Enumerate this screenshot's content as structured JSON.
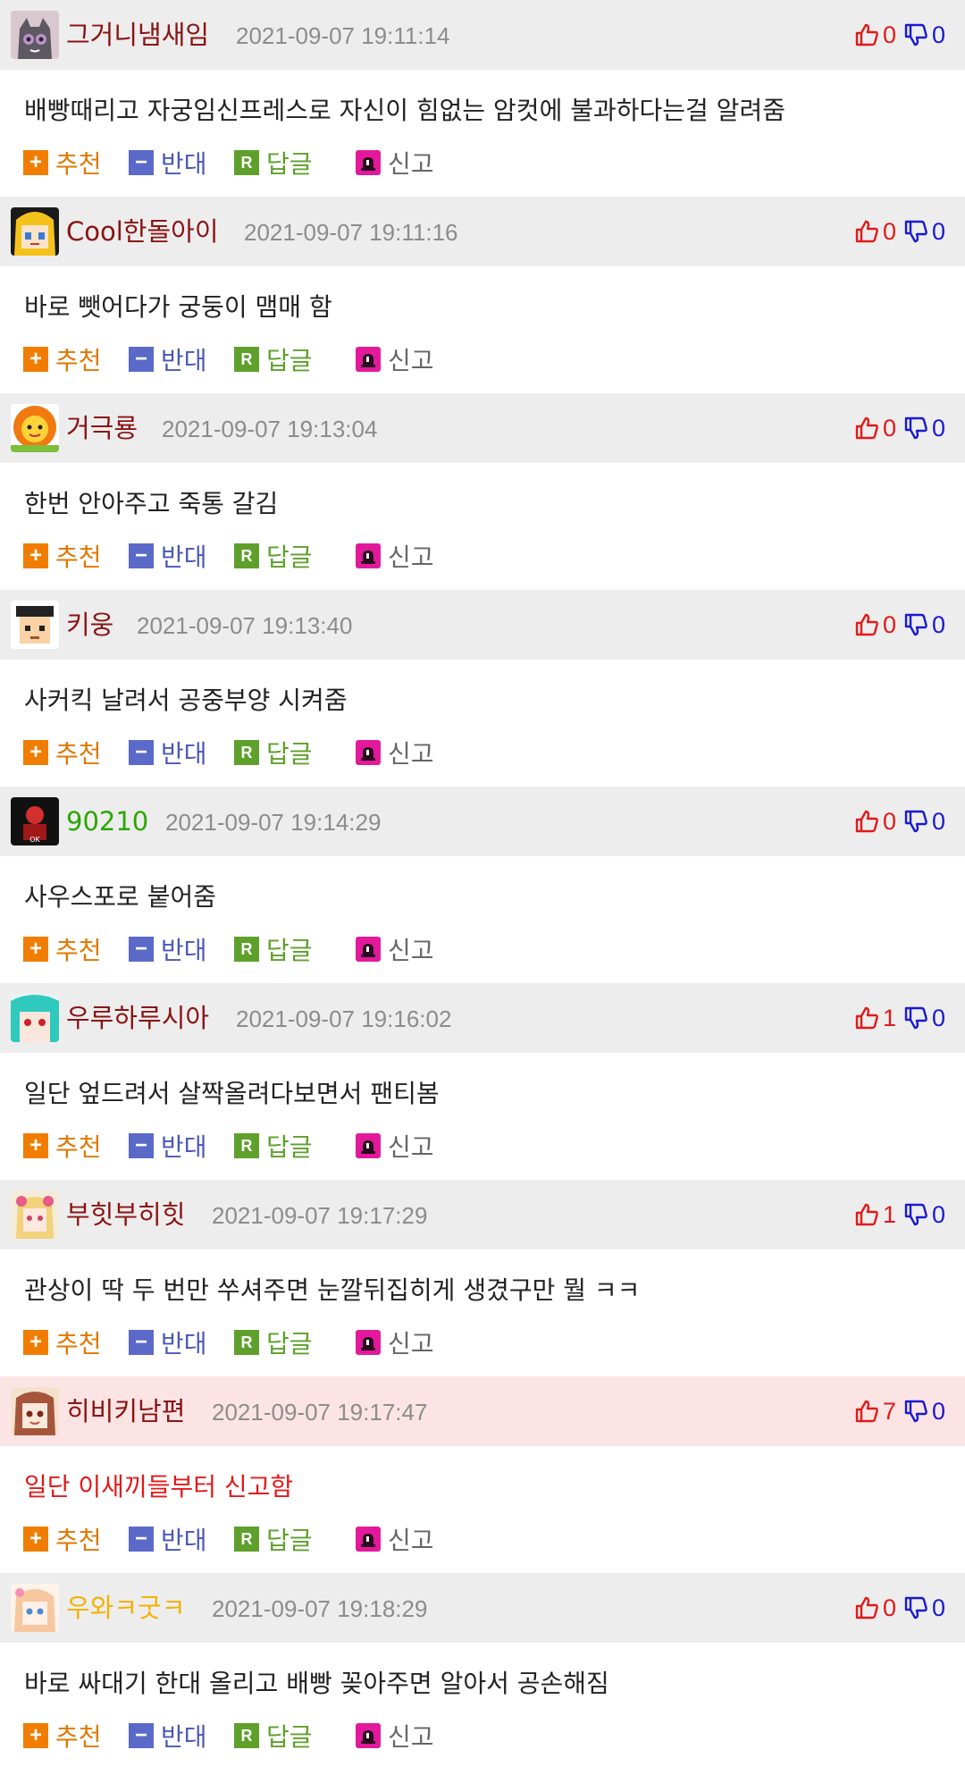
{
  "labels": {
    "recommend": "추천",
    "oppose": "반대",
    "reply": "답글",
    "report": "신고"
  },
  "comments": [
    {
      "nick": "그거니냄새임",
      "date": "2021-09-07 19:11:14",
      "up": "0",
      "down": "0",
      "text": "배빵때리고 자궁임신프레스로 자신이 힘없는 암컷에 불과하다는걸 알려줌"
    },
    {
      "nick": "Cool한돌아이",
      "date": "2021-09-07 19:11:16",
      "up": "0",
      "down": "0",
      "text": "바로 뺏어다가 궁둥이 맴매 함"
    },
    {
      "nick": "거극룡",
      "date": "2021-09-07 19:13:04",
      "up": "0",
      "down": "0",
      "text": "한번 안아주고 죽통 갈김"
    },
    {
      "nick": "키웅",
      "date": "2021-09-07 19:13:40",
      "up": "0",
      "down": "0",
      "text": "사커킥 날려서 공중부양 시켜줌"
    },
    {
      "nick": "90210",
      "date": "2021-09-07 19:14:29",
      "up": "0",
      "down": "0",
      "text": "사우스포로 붙어줌"
    },
    {
      "nick": "우루하루시아",
      "date": "2021-09-07 19:16:02",
      "up": "1",
      "down": "0",
      "text": "일단 엎드려서 살짝올려다보면서 팬티봄"
    },
    {
      "nick": "부힛부히힛",
      "date": "2021-09-07 19:17:29",
      "up": "1",
      "down": "0",
      "text": "관상이 딱 두 번만 쑤셔주면 눈깔뒤집히게 생겼구만 뭘 ㅋㅋ"
    },
    {
      "nick": "히비키남편",
      "date": "2021-09-07 19:17:47",
      "up": "7",
      "down": "0",
      "text": "일단 이새끼들부터 신고함"
    },
    {
      "nick": "우와ㅋ굿ㅋ",
      "date": "2021-09-07 19:18:29",
      "up": "0",
      "down": "0",
      "text": "바로 싸대기 한대 올리고 배빵 꽂아주면 알아서 공손해짐"
    }
  ]
}
